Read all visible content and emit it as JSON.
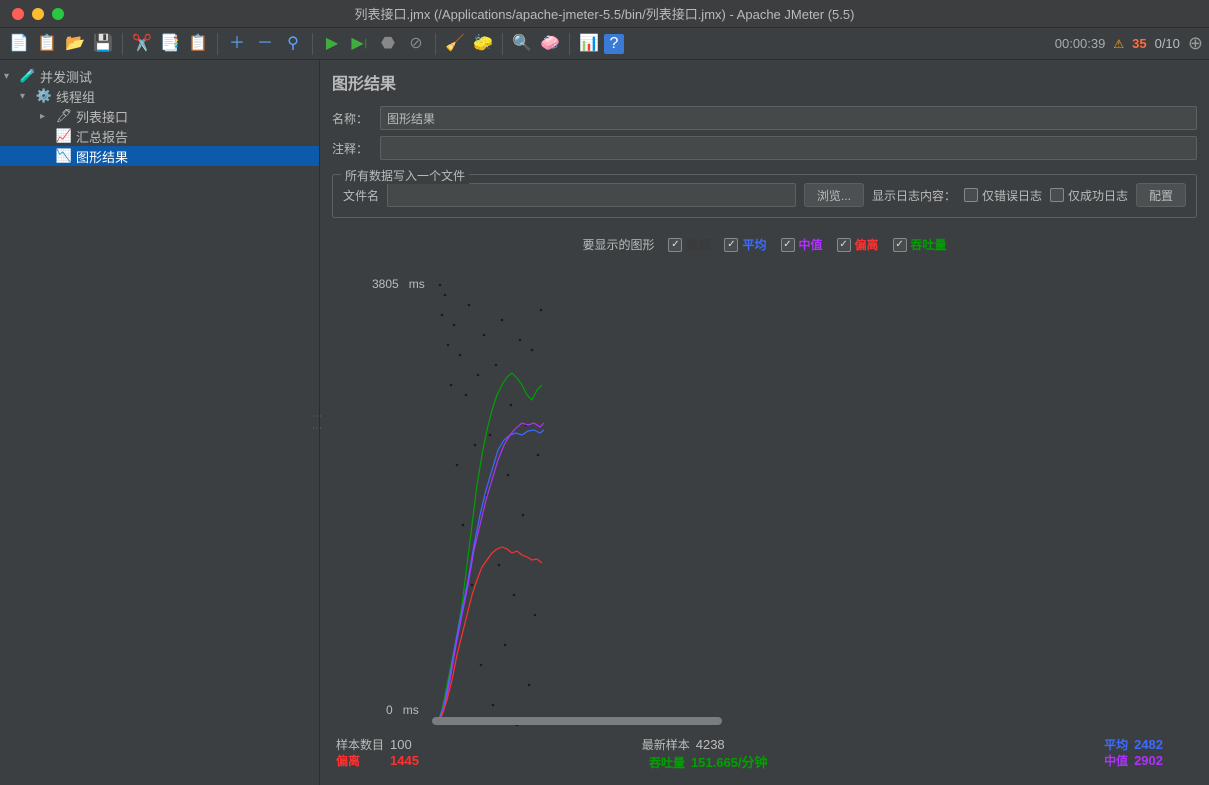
{
  "window": {
    "title": "列表接口.jmx (/Applications/apache-jmeter-5.5/bin/列表接口.jmx) - Apache JMeter (5.5)"
  },
  "toolbar": {
    "timer": "00:00:39",
    "warn_count": "35",
    "thread_count": "0/10"
  },
  "tree": {
    "root": {
      "label": "并发测试"
    },
    "thread_group": {
      "label": "线程组"
    },
    "child_request": {
      "label": "列表接口"
    },
    "child_summary": {
      "label": "汇总报告"
    },
    "child_graph": {
      "label": "图形结果"
    }
  },
  "panel": {
    "title": "图形结果",
    "name_label": "名称：",
    "name_value": "图形结果",
    "comment_label": "注释：",
    "comment_value": "",
    "fieldset_legend": "所有数据写入一个文件",
    "filename_label": "文件名",
    "filename_value": "",
    "browse_btn": "浏览...",
    "show_log_label": "显示日志内容：",
    "only_error": "仅错误日志",
    "only_success": "仅成功日志",
    "config_btn": "配置"
  },
  "graph_options": {
    "title": "要显示的图形",
    "data": "数据",
    "average": "平均",
    "median": "中值",
    "deviation": "偏离",
    "throughput": "吞吐量"
  },
  "chart_data": {
    "type": "scatter",
    "ylabel": "ms",
    "y_max": 3805,
    "y_min": 0,
    "x_samples": 100,
    "series": [
      {
        "name": "数据",
        "color": "#2b2b2b"
      },
      {
        "name": "平均",
        "color": "#3b6bff"
      },
      {
        "name": "中值",
        "color": "#b030ff"
      },
      {
        "name": "偏离",
        "color": "#ff3030"
      },
      {
        "name": "吞吐量",
        "color": "#00a000"
      }
    ],
    "y_top_label": "3805",
    "y_bot_label": "0",
    "unit": "ms"
  },
  "stats": {
    "sample_count_label": "样本数目",
    "sample_count": "100",
    "latest_label": "最新样本",
    "latest": "4238",
    "avg_label": "平均",
    "avg": "2482",
    "dev_label": "偏离",
    "dev": "1445",
    "thr_label": "吞吐量",
    "thr": "151.665/分钟",
    "med_label": "中值",
    "med": "2902"
  }
}
